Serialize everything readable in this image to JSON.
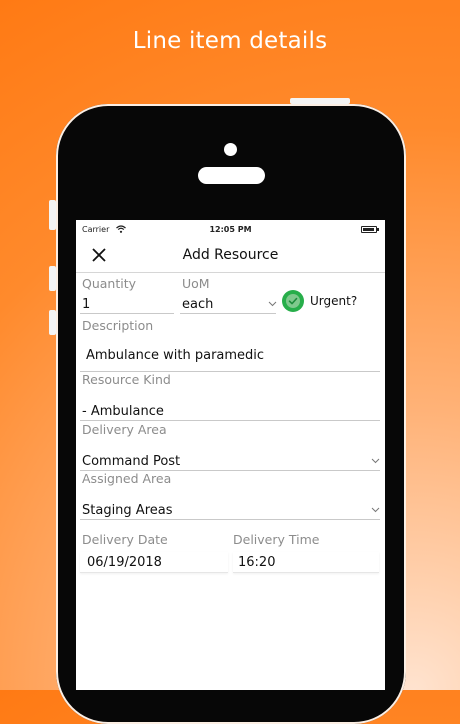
{
  "headline": "Line item details",
  "status_bar": {
    "carrier": "Carrier",
    "time": "12:05 PM"
  },
  "nav": {
    "title": "Add Resource"
  },
  "form": {
    "quantity": {
      "label": "Quantity",
      "value": "1"
    },
    "uom": {
      "label": "UoM",
      "value": "each"
    },
    "urgent": {
      "label": "Urgent?",
      "checked": true
    },
    "description": {
      "label": "Description",
      "value": "Ambulance with paramedic"
    },
    "resource_kind": {
      "label": "Resource Kind",
      "value": "- Ambulance"
    },
    "delivery_area": {
      "label": "Delivery Area",
      "value": "Command Post"
    },
    "assigned_area": {
      "label": "Assigned Area",
      "value": "Staging Areas"
    },
    "delivery_date": {
      "label": "Delivery Date",
      "value": "06/19/2018"
    },
    "delivery_time": {
      "label": "Delivery Time",
      "value": "16:20"
    }
  },
  "colors": {
    "accent_green": "#27ae4a",
    "background_orange": "#ff7a14"
  }
}
